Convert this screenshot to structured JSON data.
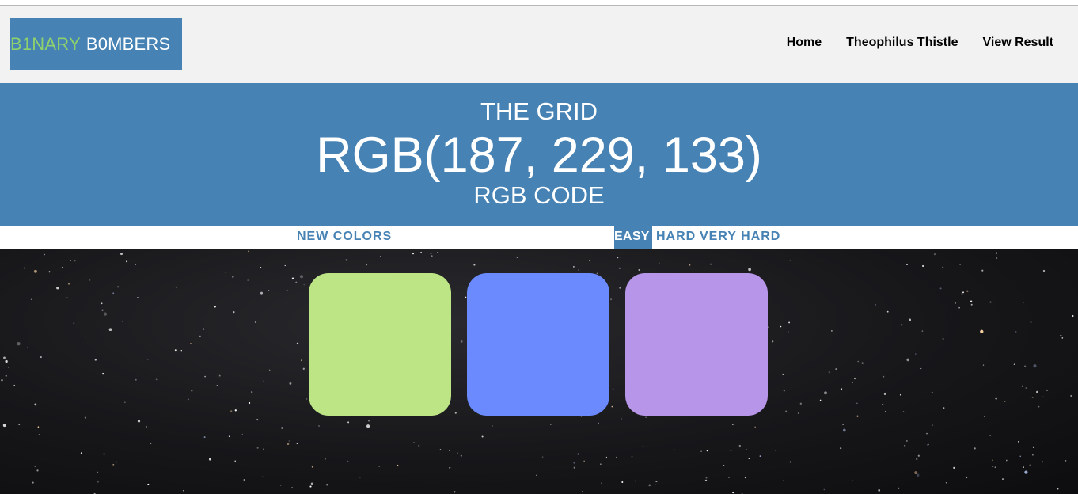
{
  "logo": {
    "part1": "B1NARY",
    "part2": "B0MBERS"
  },
  "nav": {
    "home": "Home",
    "user": "Theophilus Thistle",
    "view_result": "View Result"
  },
  "banner": {
    "title": "THE GRID",
    "rgb": "RGB(187, 229, 133)",
    "subtitle": "RGB CODE"
  },
  "controls": {
    "new_colors": "NEW COLORS",
    "easy": "EASY",
    "hard": "HARD",
    "very_hard": "VERY HARD",
    "selected": "EASY"
  },
  "squares": [
    {
      "color": "#bde585"
    },
    {
      "color": "#6b8afd"
    },
    {
      "color": "#b795e8"
    }
  ],
  "colors": {
    "accent": "#4682b4",
    "logo_green": "#8fd16c",
    "navbar_bg": "#f2f2f2"
  }
}
